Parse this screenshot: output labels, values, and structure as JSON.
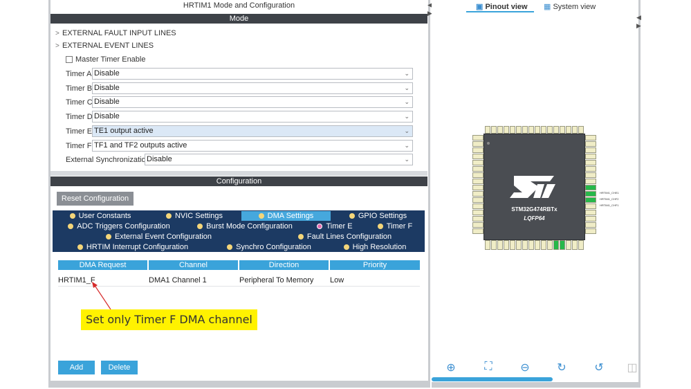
{
  "title": "HRTIM1 Mode and Configuration",
  "mode_header": "Mode",
  "tree": [
    "EXTERNAL FAULT INPUT LINES",
    "EXTERNAL EVENT LINES"
  ],
  "master_timer": "Master Timer Enable",
  "timers": [
    {
      "label": "Timer A",
      "value": "Disable"
    },
    {
      "label": "Timer B",
      "value": "Disable"
    },
    {
      "label": "Timer C",
      "value": "Disable"
    },
    {
      "label": "Timer D",
      "value": "Disable"
    },
    {
      "label": "Timer E",
      "value": "TE1 output active"
    },
    {
      "label": "Timer F",
      "value": "TF1 and TF2 outputs active"
    }
  ],
  "ext_sync": {
    "label": "External Synchronization",
    "value": "Disable"
  },
  "config_header": "Configuration",
  "reset_button": "Reset Configuration",
  "tabs": {
    "user_constants": "User Constants",
    "nvic": "NVIC Settings",
    "dma": "DMA Settings",
    "gpio": "GPIO Settings",
    "adc": "ADC Triggers Configuration",
    "burst": "Burst Mode Configuration",
    "timer_e": "Timer E",
    "timer_f": "Timer F",
    "ext_event": "External Event Configuration",
    "fault_lines": "Fault Lines Configuration",
    "interrupt": "HRTIM Interrupt Configuration",
    "synchro": "Synchro Configuration",
    "high_res": "High Resolution"
  },
  "dma_table": {
    "headers": [
      "DMA Request",
      "Channel",
      "Direction",
      "Priority"
    ],
    "rows": [
      [
        "HRTIM1_F",
        "DMA1 Channel 1",
        "Peripheral To Memory",
        "Low"
      ]
    ]
  },
  "callout": "Set only Timer F DMA channel",
  "add_button": "Add",
  "delete_button": "Delete",
  "right": {
    "pinout_tab": "Pinout view",
    "system_tab": "System view",
    "chip_name": "STM32G474RBTx",
    "package": "LQFP64",
    "pin_labels": [
      "HRTIM1_CHE1",
      "HRTIM1_CHF2",
      "HRTIM1_CHF1"
    ]
  },
  "colors": {
    "accent": "#3aa3da",
    "tab_bg": "#1c3a63",
    "header_bg": "#3e4248",
    "callout": "#fff200",
    "pin_green": "#26b84a"
  }
}
